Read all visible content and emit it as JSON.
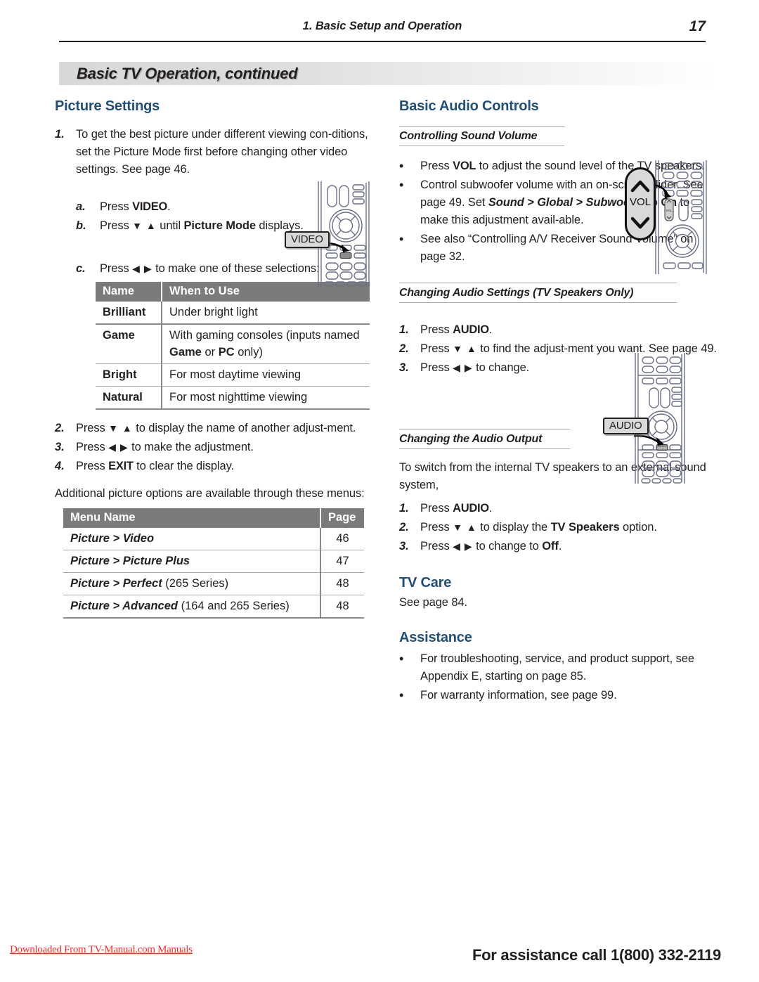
{
  "header": {
    "chapter": "1.  Basic Setup and Operation",
    "page_number": "17",
    "banner_title": "Basic TV Operation, continued"
  },
  "left": {
    "picture_settings": {
      "heading": "Picture Settings",
      "step1_mark": "1.",
      "step1_text": "To get the best picture under different viewing con-ditions, set the Picture Mode first before changing other video settings.  See page 46.",
      "step_a_mark": "a.",
      "step_a_pre": "Press ",
      "step_a_key": "VIDEO",
      "step_a_post": ".",
      "step_b_mark": "b.",
      "step_b_pre": "Press ",
      "step_b_arrows": "▼ ▲",
      "step_b_mid": " until ",
      "step_b_bold": "Picture Mode",
      "step_b_post": " displays.",
      "step_c_mark": "c.",
      "step_c_pre": "Press ",
      "step_c_arrows": "◀ ▶",
      "step_c_post": " to make one of these selections:",
      "step2_mark": "2.",
      "step2_pre": "Press ",
      "step2_arrows": "▼ ▲",
      "step2_post": " to display the name of another adjust-ment.",
      "step3_mark": "3.",
      "step3_pre": "Press ",
      "step3_arrows": "◀ ▶",
      "step3_post": " to make the adjustment.",
      "step4_mark": "4.",
      "step4_pre": "Press ",
      "step4_key": "EXIT",
      "step4_post": " to clear the display.",
      "additional_para": "Additional picture options are available through these menus:"
    },
    "modes_table": {
      "headers": [
        "Name",
        "When to Use"
      ],
      "rows": [
        {
          "name": "Brilliant",
          "use_plain": "Under bright light",
          "use_parts": null
        },
        {
          "name": "Game",
          "use_plain": null,
          "use_parts": [
            "With gaming consoles (inputs named ",
            "Game",
            " or ",
            "PC",
            " only)"
          ]
        },
        {
          "name": "Bright",
          "use_plain": "For most daytime viewing",
          "use_parts": null
        },
        {
          "name": "Natural",
          "use_plain": "For most nighttime viewing",
          "use_parts": null
        }
      ]
    },
    "menus_table": {
      "headers": [
        "Menu Name",
        "Page"
      ],
      "rows": [
        {
          "menu_bold": "Picture > Video",
          "menu_tail": "",
          "page": "46"
        },
        {
          "menu_bold": "Picture > Picture Plus",
          "menu_tail": "",
          "page": "47"
        },
        {
          "menu_bold": "Picture > Perfect",
          "menu_tail": " (265 Series)",
          "page": "48"
        },
        {
          "menu_bold": "Picture > Advanced",
          "menu_tail": " (164 and 265 Series)",
          "page": "48"
        }
      ]
    },
    "callout_video": "VIDEO"
  },
  "right": {
    "audio_controls": {
      "heading": "Basic Audio Controls",
      "subsec_volume": "Controlling Sound Volume",
      "bullet": "•",
      "b1_pre": "Press ",
      "b1_key": "VOL",
      "b1_post": " to adjust the sound level of the TV speakers.",
      "b2_pre": "Control subwoofer volume with an on-screen slider.  See page 49.  Set ",
      "b2_bi": "Sound > Global > Subwoofer",
      "b2_mid": " to ",
      "b2_bold": "On",
      "b2_post": " to make this adjustment avail-able.",
      "b3_text": "See also  “Controlling A/V Receiver Sound Volume” on page 32."
    },
    "audio_settings": {
      "subsec": "Changing Audio Settings (TV Speakers Only)",
      "s1_mark": "1.",
      "s1_pre": "Press ",
      "s1_key": "AUDIO",
      "s1_post": ".",
      "s2_mark": "2.",
      "s2_pre": "Press ",
      "s2_arrows": "▼ ▲",
      "s2_post": " to find the adjust-ment you want.  See page 49.",
      "s3_mark": "3.",
      "s3_pre": "Press ",
      "s3_arrows": "◀ ▶",
      "s3_post": " to change."
    },
    "audio_output": {
      "subsec": "Changing the Audio Output",
      "intro": "To switch from the internal TV speakers to an external sound system,",
      "s1_mark": "1.",
      "s1_pre": "Press ",
      "s1_key": "AUDIO",
      "s1_post": ".",
      "s2_mark": "2.",
      "s2_pre": "Press ",
      "s2_arrows": "▼ ▲",
      "s2_mid": " to display the ",
      "s2_bold": "TV Speakers",
      "s2_post": " option.",
      "s3_mark": "3.",
      "s3_pre": "Press ",
      "s3_arrows": "◀ ▶",
      "s3_mid": " to change to ",
      "s3_bold": "Off",
      "s3_post": "."
    },
    "tv_care": {
      "heading": "TV Care",
      "text": "See page 84."
    },
    "assistance": {
      "heading": "Assistance",
      "bullet": "•",
      "b1": "For troubleshooting, service, and product support, see Appendix E, starting on page 85.",
      "b2": "For warranty information, see page 99."
    },
    "callout_vol": "VOL",
    "callout_audio": "AUDIO",
    "vol_label": "VOL"
  },
  "footer": {
    "left": "Downloaded From TV-Manual.com Manuals",
    "right": "For assistance call 1(800) 332-2119"
  },
  "colors": {
    "heading_blue": "#1f4e79",
    "table_header_gray": "#7b7b7b",
    "rule_gray": "#a7a9ac",
    "footer_red": "#ff2b2b",
    "remote_outline": "#5b5f7a"
  }
}
